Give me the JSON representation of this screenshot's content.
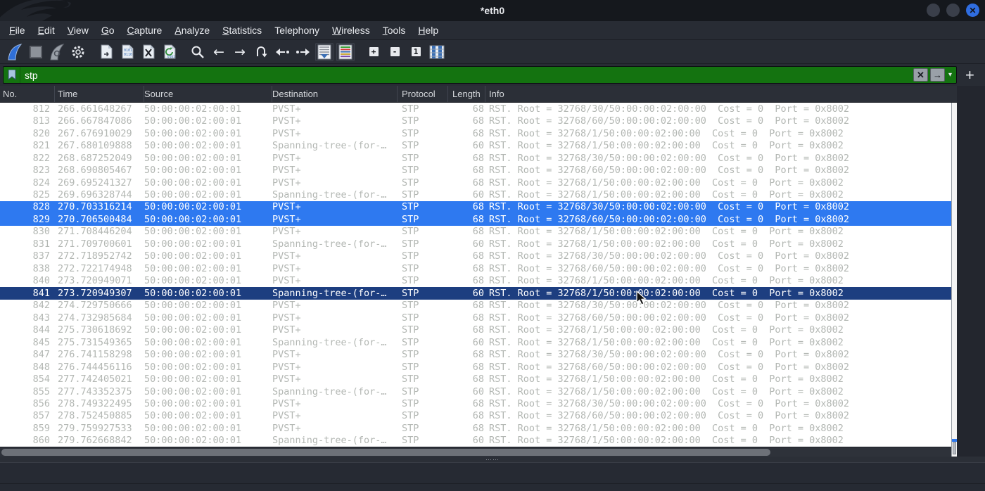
{
  "window": {
    "title": "*eth0",
    "controls": [
      {
        "name": "minimize-button"
      },
      {
        "name": "maximize-button"
      },
      {
        "name": "close-button",
        "glyph": "✕"
      }
    ]
  },
  "menu": {
    "items": [
      {
        "label": "File",
        "underline": 0
      },
      {
        "label": "Edit",
        "underline": 0
      },
      {
        "label": "View",
        "underline": 0
      },
      {
        "label": "Go",
        "underline": 0
      },
      {
        "label": "Capture",
        "underline": 0
      },
      {
        "label": "Analyze",
        "underline": 0
      },
      {
        "label": "Statistics",
        "underline": 0
      },
      {
        "label": "Telephony",
        "underline": -1
      },
      {
        "label": "Wireless",
        "underline": 0
      },
      {
        "label": "Tools",
        "underline": 0
      },
      {
        "label": "Help",
        "underline": 0
      }
    ]
  },
  "toolbar": {
    "icons": [
      "start-capture-icon",
      "stop-capture-icon",
      "restart-capture-icon",
      "capture-options-icon",
      "separator",
      "open-file-icon",
      "save-file-icon",
      "close-file-icon",
      "reload-file-icon",
      "separator",
      "find-packet-icon",
      "go-back-icon",
      "go-forward-icon",
      "goto-packet-icon",
      "first-packet-icon",
      "last-packet-icon",
      "auto-scroll-icon",
      "colorize-icon",
      "separator",
      "zoom-in-icon",
      "zoom-out-icon",
      "normal-size-icon",
      "resize-columns-icon"
    ],
    "zoom_in_label": "+",
    "zoom_out_label": "-",
    "normal_size_label": "1"
  },
  "filter": {
    "value": "stp",
    "clear_label": "✕",
    "apply_label": "→",
    "dropdown_label": "▾",
    "add_label": "+"
  },
  "columns": [
    "No.",
    "Time",
    "Source",
    "Destination",
    "Protocol",
    "Length",
    "Info"
  ],
  "packets": {
    "rows": [
      {
        "no": "812",
        "time": "266.661648267",
        "source": "50:00:00:02:00:01",
        "destination": "PVST+",
        "protocol": "STP",
        "length": "68",
        "info": "RST. Root = 32768/30/50:00:00:02:00:00  Cost = 0  Port = 0x8002",
        "state": "normal"
      },
      {
        "no": "813",
        "time": "266.667847086",
        "source": "50:00:00:02:00:01",
        "destination": "PVST+",
        "protocol": "STP",
        "length": "68",
        "info": "RST. Root = 32768/60/50:00:00:02:00:00  Cost = 0  Port = 0x8002",
        "state": "normal"
      },
      {
        "no": "820",
        "time": "267.676910029",
        "source": "50:00:00:02:00:01",
        "destination": "PVST+",
        "protocol": "STP",
        "length": "68",
        "info": "RST. Root = 32768/1/50:00:00:02:00:00  Cost = 0  Port = 0x8002",
        "state": "normal"
      },
      {
        "no": "821",
        "time": "267.680109888",
        "source": "50:00:00:02:00:01",
        "destination": "Spanning-tree-(for-…",
        "protocol": "STP",
        "length": "60",
        "info": "RST. Root = 32768/1/50:00:00:02:00:00  Cost = 0  Port = 0x8002",
        "state": "normal"
      },
      {
        "no": "822",
        "time": "268.687252049",
        "source": "50:00:00:02:00:01",
        "destination": "PVST+",
        "protocol": "STP",
        "length": "68",
        "info": "RST. Root = 32768/30/50:00:00:02:00:00  Cost = 0  Port = 0x8002",
        "state": "normal"
      },
      {
        "no": "823",
        "time": "268.690805467",
        "source": "50:00:00:02:00:01",
        "destination": "PVST+",
        "protocol": "STP",
        "length": "68",
        "info": "RST. Root = 32768/60/50:00:00:02:00:00  Cost = 0  Port = 0x8002",
        "state": "normal"
      },
      {
        "no": "824",
        "time": "269.695241327",
        "source": "50:00:00:02:00:01",
        "destination": "PVST+",
        "protocol": "STP",
        "length": "68",
        "info": "RST. Root = 32768/1/50:00:00:02:00:00  Cost = 0  Port = 0x8002",
        "state": "normal"
      },
      {
        "no": "825",
        "time": "269.696328744",
        "source": "50:00:00:02:00:01",
        "destination": "Spanning-tree-(for-…",
        "protocol": "STP",
        "length": "60",
        "info": "RST. Root = 32768/1/50:00:00:02:00:00  Cost = 0  Port = 0x8002",
        "state": "normal"
      },
      {
        "no": "828",
        "time": "270.703316214",
        "source": "50:00:00:02:00:01",
        "destination": "PVST+",
        "protocol": "STP",
        "length": "68",
        "info": "RST. Root = 32768/30/50:00:00:02:00:00  Cost = 0  Port = 0x8002",
        "state": "selected"
      },
      {
        "no": "829",
        "time": "270.706500484",
        "source": "50:00:00:02:00:01",
        "destination": "PVST+",
        "protocol": "STP",
        "length": "68",
        "info": "RST. Root = 32768/60/50:00:00:02:00:00  Cost = 0  Port = 0x8002",
        "state": "selected"
      },
      {
        "no": "830",
        "time": "271.708446204",
        "source": "50:00:00:02:00:01",
        "destination": "PVST+",
        "protocol": "STP",
        "length": "68",
        "info": "RST. Root = 32768/1/50:00:00:02:00:00  Cost = 0  Port = 0x8002",
        "state": "normal"
      },
      {
        "no": "831",
        "time": "271.709700601",
        "source": "50:00:00:02:00:01",
        "destination": "Spanning-tree-(for-…",
        "protocol": "STP",
        "length": "60",
        "info": "RST. Root = 32768/1/50:00:00:02:00:00  Cost = 0  Port = 0x8002",
        "state": "normal"
      },
      {
        "no": "837",
        "time": "272.718952742",
        "source": "50:00:00:02:00:01",
        "destination": "PVST+",
        "protocol": "STP",
        "length": "68",
        "info": "RST. Root = 32768/30/50:00:00:02:00:00  Cost = 0  Port = 0x8002",
        "state": "normal"
      },
      {
        "no": "838",
        "time": "272.722174948",
        "source": "50:00:00:02:00:01",
        "destination": "PVST+",
        "protocol": "STP",
        "length": "68",
        "info": "RST. Root = 32768/60/50:00:00:02:00:00  Cost = 0  Port = 0x8002",
        "state": "normal"
      },
      {
        "no": "840",
        "time": "273.720949071",
        "source": "50:00:00:02:00:01",
        "destination": "PVST+",
        "protocol": "STP",
        "length": "68",
        "info": "RST. Root = 32768/1/50:00:00:02:00:00  Cost = 0  Port = 0x8002",
        "state": "normal"
      },
      {
        "no": "841",
        "time": "273.720949307",
        "source": "50:00:00:02:00:01",
        "destination": "Spanning-tree-(for-…",
        "protocol": "STP",
        "length": "60",
        "info": "RST. Root = 32768/1/50:00:00:02:00:00  Cost = 0  Port = 0x8002",
        "state": "current"
      },
      {
        "no": "842",
        "time": "274.729750666",
        "source": "50:00:00:02:00:01",
        "destination": "PVST+",
        "protocol": "STP",
        "length": "68",
        "info": "RST. Root = 32768/30/50:00:00:02:00:00  Cost = 0  Port = 0x8002",
        "state": "normal"
      },
      {
        "no": "843",
        "time": "274.732985684",
        "source": "50:00:00:02:00:01",
        "destination": "PVST+",
        "protocol": "STP",
        "length": "68",
        "info": "RST. Root = 32768/60/50:00:00:02:00:00  Cost = 0  Port = 0x8002",
        "state": "normal"
      },
      {
        "no": "844",
        "time": "275.730618692",
        "source": "50:00:00:02:00:01",
        "destination": "PVST+",
        "protocol": "STP",
        "length": "68",
        "info": "RST. Root = 32768/1/50:00:00:02:00:00  Cost = 0  Port = 0x8002",
        "state": "normal"
      },
      {
        "no": "845",
        "time": "275.731549365",
        "source": "50:00:00:02:00:01",
        "destination": "Spanning-tree-(for-…",
        "protocol": "STP",
        "length": "60",
        "info": "RST. Root = 32768/1/50:00:00:02:00:00  Cost = 0  Port = 0x8002",
        "state": "normal"
      },
      {
        "no": "847",
        "time": "276.741158298",
        "source": "50:00:00:02:00:01",
        "destination": "PVST+",
        "protocol": "STP",
        "length": "68",
        "info": "RST. Root = 32768/30/50:00:00:02:00:00  Cost = 0  Port = 0x8002",
        "state": "normal"
      },
      {
        "no": "848",
        "time": "276.744456116",
        "source": "50:00:00:02:00:01",
        "destination": "PVST+",
        "protocol": "STP",
        "length": "68",
        "info": "RST. Root = 32768/60/50:00:00:02:00:00  Cost = 0  Port = 0x8002",
        "state": "normal"
      },
      {
        "no": "854",
        "time": "277.742405021",
        "source": "50:00:00:02:00:01",
        "destination": "PVST+",
        "protocol": "STP",
        "length": "68",
        "info": "RST. Root = 32768/1/50:00:00:02:00:00  Cost = 0  Port = 0x8002",
        "state": "normal"
      },
      {
        "no": "855",
        "time": "277.743352375",
        "source": "50:00:00:02:00:01",
        "destination": "Spanning-tree-(for-…",
        "protocol": "STP",
        "length": "60",
        "info": "RST. Root = 32768/1/50:00:00:02:00:00  Cost = 0  Port = 0x8002",
        "state": "normal"
      },
      {
        "no": "856",
        "time": "278.749322495",
        "source": "50:00:00:02:00:01",
        "destination": "PVST+",
        "protocol": "STP",
        "length": "68",
        "info": "RST. Root = 32768/30/50:00:00:02:00:00  Cost = 0  Port = 0x8002",
        "state": "normal"
      },
      {
        "no": "857",
        "time": "278.752450885",
        "source": "50:00:00:02:00:01",
        "destination": "PVST+",
        "protocol": "STP",
        "length": "68",
        "info": "RST. Root = 32768/60/50:00:00:02:00:00  Cost = 0  Port = 0x8002",
        "state": "normal"
      },
      {
        "no": "859",
        "time": "279.759927533",
        "source": "50:00:00:02:00:01",
        "destination": "PVST+",
        "protocol": "STP",
        "length": "68",
        "info": "RST. Root = 32768/1/50:00:00:02:00:00  Cost = 0  Port = 0x8002",
        "state": "normal"
      },
      {
        "no": "860",
        "time": "279.762668842",
        "source": "50:00:00:02:00:01",
        "destination": "Spanning-tree-(for-…",
        "protocol": "STP",
        "length": "60",
        "info": "RST. Root = 32768/1/50:00:00:02:00:00  Cost = 0  Port = 0x8002",
        "state": "normal"
      }
    ]
  },
  "colors": {
    "filter_valid_bg": "#147310",
    "selected_row_bg": "#2e79f0",
    "current_row_bg": "#1d3e80",
    "row_text": "#b3b7b3",
    "accent_blue": "#2f6de0"
  },
  "splitter": {
    "grip": "⋯⋯"
  }
}
